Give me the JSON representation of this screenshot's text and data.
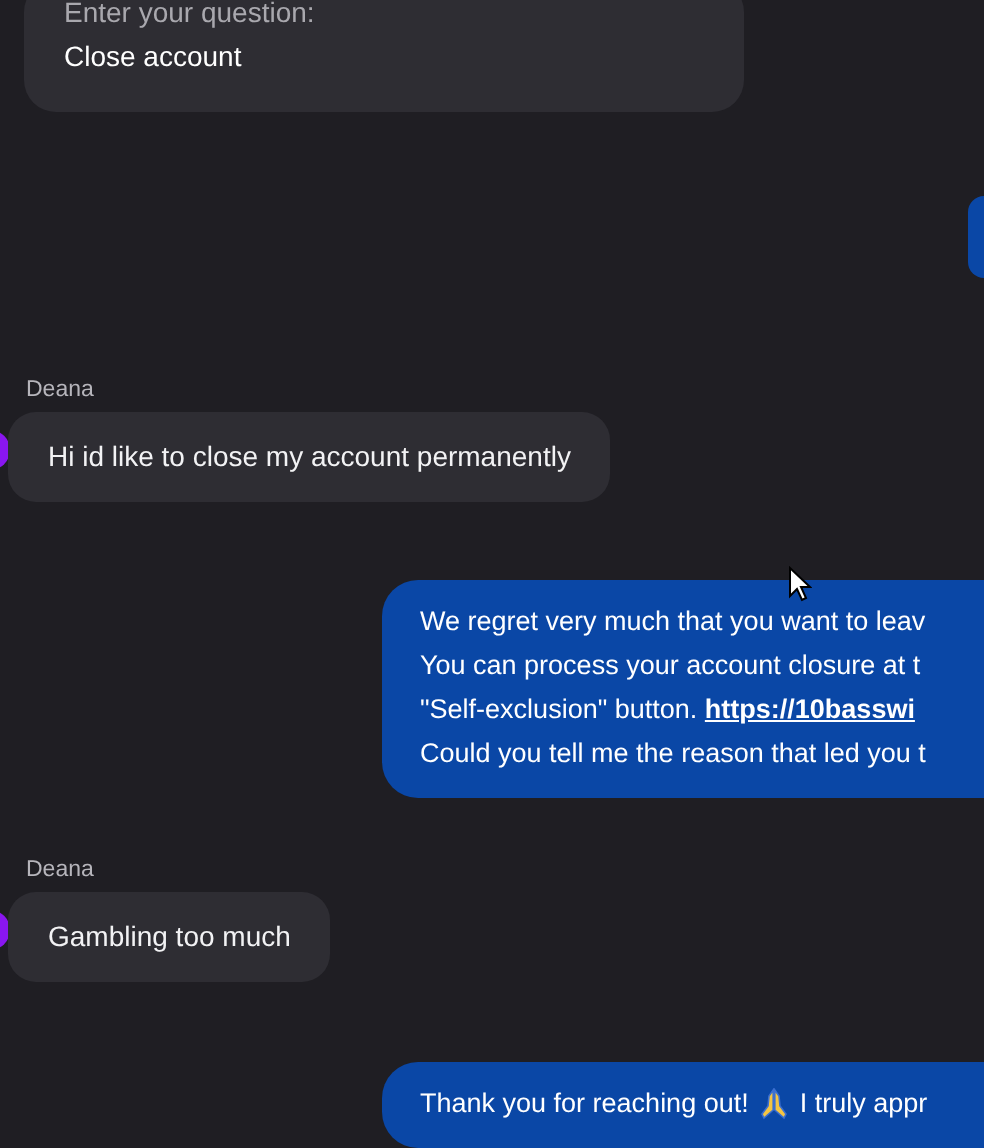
{
  "messages": [
    {
      "kind": "system",
      "lines": [
        "Enter your question:",
        "Close account"
      ]
    },
    {
      "kind": "agent_partial"
    },
    {
      "kind": "user",
      "sender": "Deana",
      "lines": [
        "Hi id like to close my account permanently"
      ]
    },
    {
      "kind": "agent",
      "lines": [
        [
          {
            "kind": "text",
            "text": "We regret very much that you want to leav"
          }
        ],
        [
          {
            "kind": "text",
            "text": "You can process your account closure at t"
          }
        ],
        [
          {
            "kind": "text",
            "text": "\"Self-exclusion\" button. "
          },
          {
            "kind": "link",
            "text": "https://10basswi"
          }
        ],
        [
          {
            "kind": "text",
            "text": "Could you tell me the reason that led you t"
          }
        ]
      ]
    },
    {
      "kind": "user",
      "sender": "Deana",
      "lines": [
        "Gambling too much"
      ]
    },
    {
      "kind": "agent",
      "lines": [
        [
          {
            "kind": "text",
            "text": "Thank you for reaching out! "
          },
          {
            "kind": "emoji"
          },
          {
            "kind": "text",
            "text": " I truly appr"
          }
        ]
      ]
    }
  ]
}
